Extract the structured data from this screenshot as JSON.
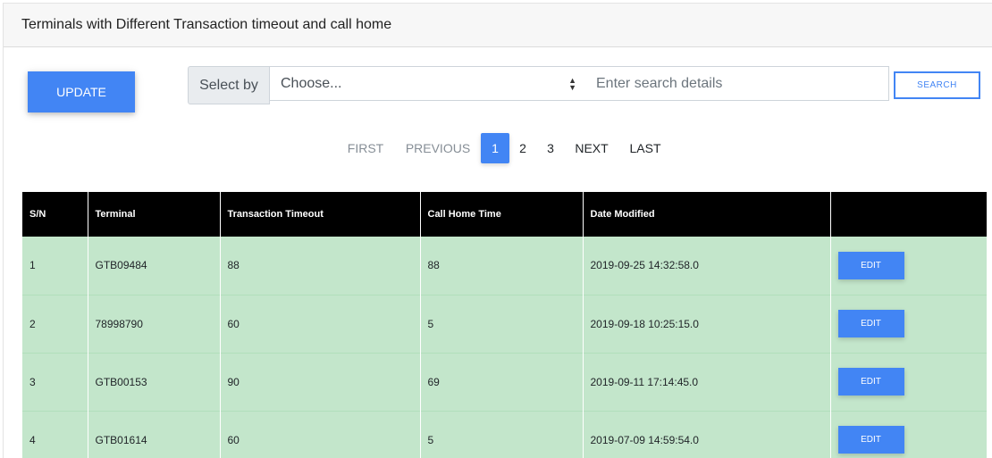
{
  "header": {
    "title": "Terminals with Different Transaction timeout and call home"
  },
  "toolbar": {
    "update_label": "UPDATE",
    "select_by_label": "Select by",
    "select_value": "Choose...",
    "search_placeholder": "Enter search details",
    "search_label": "SEARCH"
  },
  "pagination": {
    "first": "FIRST",
    "previous": "PREVIOUS",
    "pages": [
      "1",
      "2",
      "3"
    ],
    "current": "1",
    "next": "NEXT",
    "last": "LAST"
  },
  "table": {
    "columns": [
      "S/N",
      "Terminal",
      "Transaction Timeout",
      "Call Home Time",
      "Date Modified",
      ""
    ],
    "edit_label": "EDIT",
    "row_color": "#c3e6cb",
    "header_color": "#000000",
    "rows": [
      {
        "sn": "1",
        "terminal": "GTB09484",
        "timeout": "88",
        "call_home": "88",
        "date": "2019-09-25 14:32:58.0"
      },
      {
        "sn": "2",
        "terminal": "78998790",
        "timeout": "60",
        "call_home": "5",
        "date": "2019-09-18 10:25:15.0"
      },
      {
        "sn": "3",
        "terminal": "GTB00153",
        "timeout": "90",
        "call_home": "69",
        "date": "2019-09-11 17:14:45.0"
      },
      {
        "sn": "4",
        "terminal": "GTB01614",
        "timeout": "60",
        "call_home": "5",
        "date": "2019-07-09 14:59:54.0"
      }
    ]
  },
  "colors": {
    "accent": "#4285f4"
  }
}
